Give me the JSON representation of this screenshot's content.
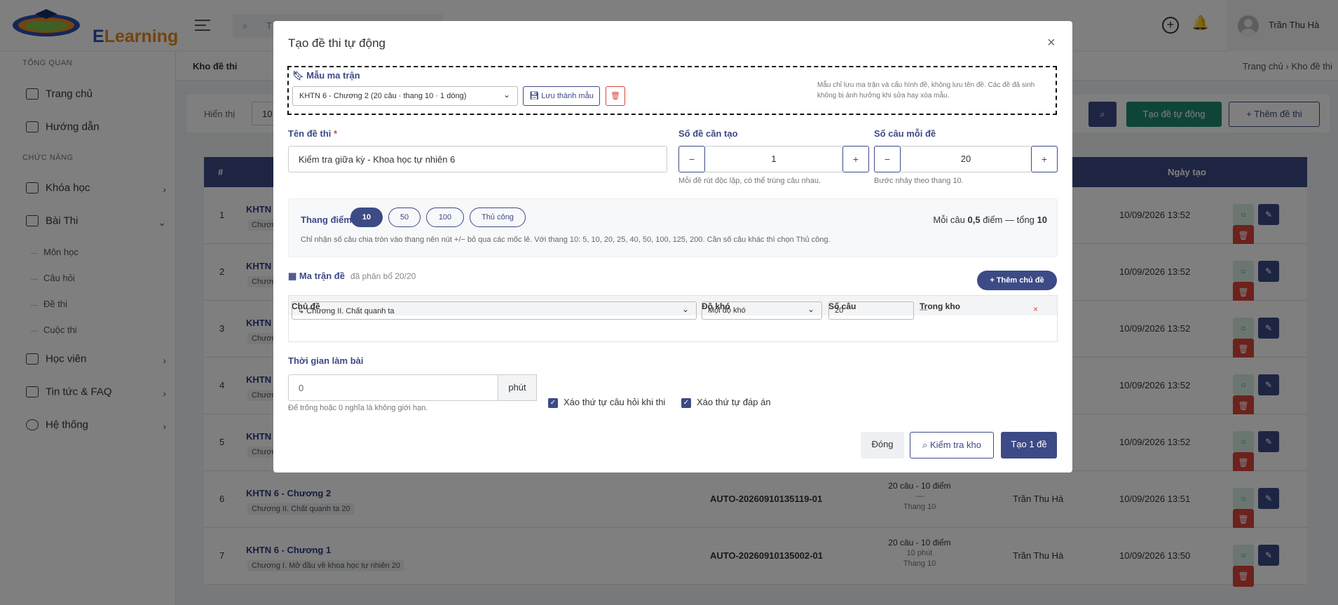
{
  "app": {
    "logo_text_a": "E",
    "logo_text_b": "Learning",
    "search_placeholder": "T",
    "user": "Trần Thu Hà"
  },
  "sidebar": {
    "sec1": "TỔNG QUAN",
    "home": "Trang chủ",
    "guide": "Hướng dẫn",
    "sec2": "CHỨC NĂNG",
    "course": "Khóa học",
    "exam": "Bài Thi",
    "sub1": "Môn học",
    "sub2": "Câu hỏi",
    "sub3": "Đề thi",
    "sub4": "Cuộc thi",
    "students": "Học viên",
    "news": "Tin tức & FAQ",
    "system": "Hệ thống"
  },
  "page": {
    "title": "Kho đề thi",
    "breadcrumb": "Trang chủ  ›  Kho đề thi",
    "show_label": "Hiển thị",
    "show_value": "10",
    "auto_btn": "Tạo đề tự động",
    "add_btn": "+ Thêm đề thi"
  },
  "table": {
    "col_num": "#",
    "col_date": "Ngày tạo",
    "rows": [
      {
        "num": "1",
        "name": "KHTN (",
        "tag": "Chươn",
        "code": "",
        "cau": "",
        "time": "",
        "scale": "",
        "by": "",
        "date": "10/09/2026 13:52"
      },
      {
        "num": "2",
        "name": "KHTN (",
        "tag": "Chươn",
        "code": "",
        "cau": "",
        "time": "",
        "scale": "",
        "by": "",
        "date": "10/09/2026 13:52"
      },
      {
        "num": "3",
        "name": "KHTN (",
        "tag": "Chươn",
        "code": "",
        "cau": "",
        "time": "",
        "scale": "",
        "by": "",
        "date": "10/09/2026 13:52"
      },
      {
        "num": "4",
        "name": "KHTN (",
        "tag": "Chươn",
        "code": "",
        "cau": "",
        "time": "",
        "scale": "",
        "by": "",
        "date": "10/09/2026 13:52"
      },
      {
        "num": "5",
        "name": "KHTN (",
        "tag": "Chươn",
        "code": "",
        "cau": "",
        "time": "",
        "scale": "",
        "by": "",
        "date": "10/09/2026 13:52"
      },
      {
        "num": "6",
        "name": "KHTN 6 - Chương 2",
        "tag": "Chương II. Chất quanh ta 20",
        "code": "AUTO-20260910135119-01",
        "cau": "20 câu - 10 điểm",
        "time": "—",
        "scale": "Thang 10",
        "by": "Trần Thu Hà",
        "date": "10/09/2026 13:51"
      },
      {
        "num": "7",
        "name": "KHTN 6 - Chương 1",
        "tag": "Chương I. Mở đầu về khoa học tự nhiên 20",
        "code": "AUTO-20260910135002-01",
        "cau": "20 câu - 10 điểm",
        "time": "10 phút",
        "scale": "Thang 10",
        "by": "Trần Thu Hà",
        "date": "10/09/2026 13:50"
      }
    ]
  },
  "modal": {
    "title": "Tạo đề thi tự động",
    "template_label": "Mẫu ma trận",
    "template_value": "KHTN 6 - Chương 2 (20 câu · thang 10 · 1 dòng)",
    "save_template": "Lưu thành mẫu",
    "template_note": "Mẫu chỉ lưu ma trận và cấu hình đề, không lưu tên đề. Các đề đã sinh không bị ảnh hưởng khi sửa hay xóa mẫu.",
    "name_label": "Tên đề thi",
    "name_value": "Kiểm tra giữa kỳ - Khoa học tự nhiên 6",
    "count_label": "Số đề cần tạo",
    "count_value": "1",
    "count_hint": "Mỗi đề rút độc lập, có thể trùng câu nhau.",
    "per_label": "Số câu mỗi đề",
    "per_value": "20",
    "per_hint": "Bước nhảy theo thang 10.",
    "scale_label": "Thang điểm:",
    "scales": [
      "10",
      "50",
      "100",
      "Thủ công"
    ],
    "scale_sum_a": "Mỗi câu ",
    "scale_sum_b": "0,5",
    "scale_sum_c": " điểm — tổng ",
    "scale_sum_d": "10",
    "scale_note": "Chỉ nhận số câu chia tròn vào thang nên nút +/− bỏ qua các mốc lẻ. Với thang 10: 5, 10, 20, 25, 40, 50, 100, 125, 200. Cần số câu khác thì chọn Thủ công.",
    "matrix_label": "Ma trận đề",
    "matrix_sub": "đã phân bổ 20/20",
    "add_topic": "+ Thêm chủ đề",
    "mcols": {
      "topic": "Chủ đề",
      "level": "Độ khó",
      "qty": "Số câu",
      "stock": "Trong kho"
    },
    "mrow": {
      "topic": "↳ Chương II. Chất quanh ta",
      "level": "Mọi độ khó",
      "qty": "20",
      "stock": "—"
    },
    "time_label": "Thời gian làm bài",
    "time_value": "0",
    "time_unit": "phút",
    "time_hint": "Để trống hoặc 0 nghĩa là không giới hạn.",
    "shuffle_q": "Xáo thứ tự câu hỏi khi thi",
    "shuffle_a": "Xáo thứ tự đáp án",
    "close": "Đóng",
    "check": "Kiểm tra kho",
    "create": "Tạo 1 đề"
  }
}
